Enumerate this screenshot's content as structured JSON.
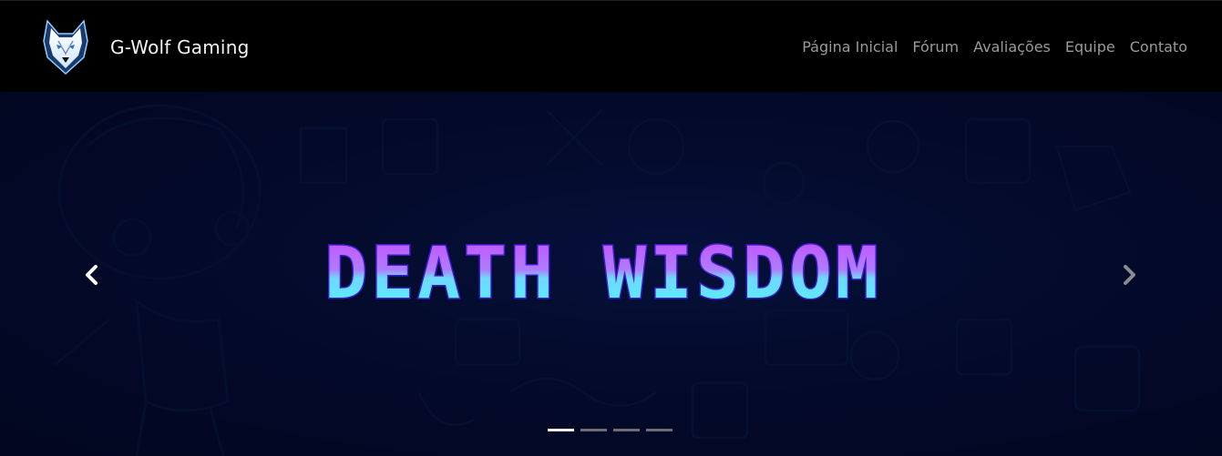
{
  "brand": {
    "name": "G-Wolf Gaming",
    "logo_icon": "wolf-head-icon"
  },
  "nav": {
    "items": [
      {
        "label": "Página Inicial"
      },
      {
        "label": "Fórum"
      },
      {
        "label": "Avaliações"
      },
      {
        "label": "Equipe"
      },
      {
        "label": "Contato"
      }
    ]
  },
  "carousel": {
    "slide_title": "DEATH WISDOM",
    "prev_icon": "chevron-left-icon",
    "next_icon": "chevron-right-icon",
    "indicator_count": 4,
    "active_indicator": 0
  },
  "colors": {
    "nav_text": "#9a9a9a",
    "title_top": "#c34bff",
    "title_bottom": "#55f6ff",
    "title_outline": "#3a1bb8"
  }
}
